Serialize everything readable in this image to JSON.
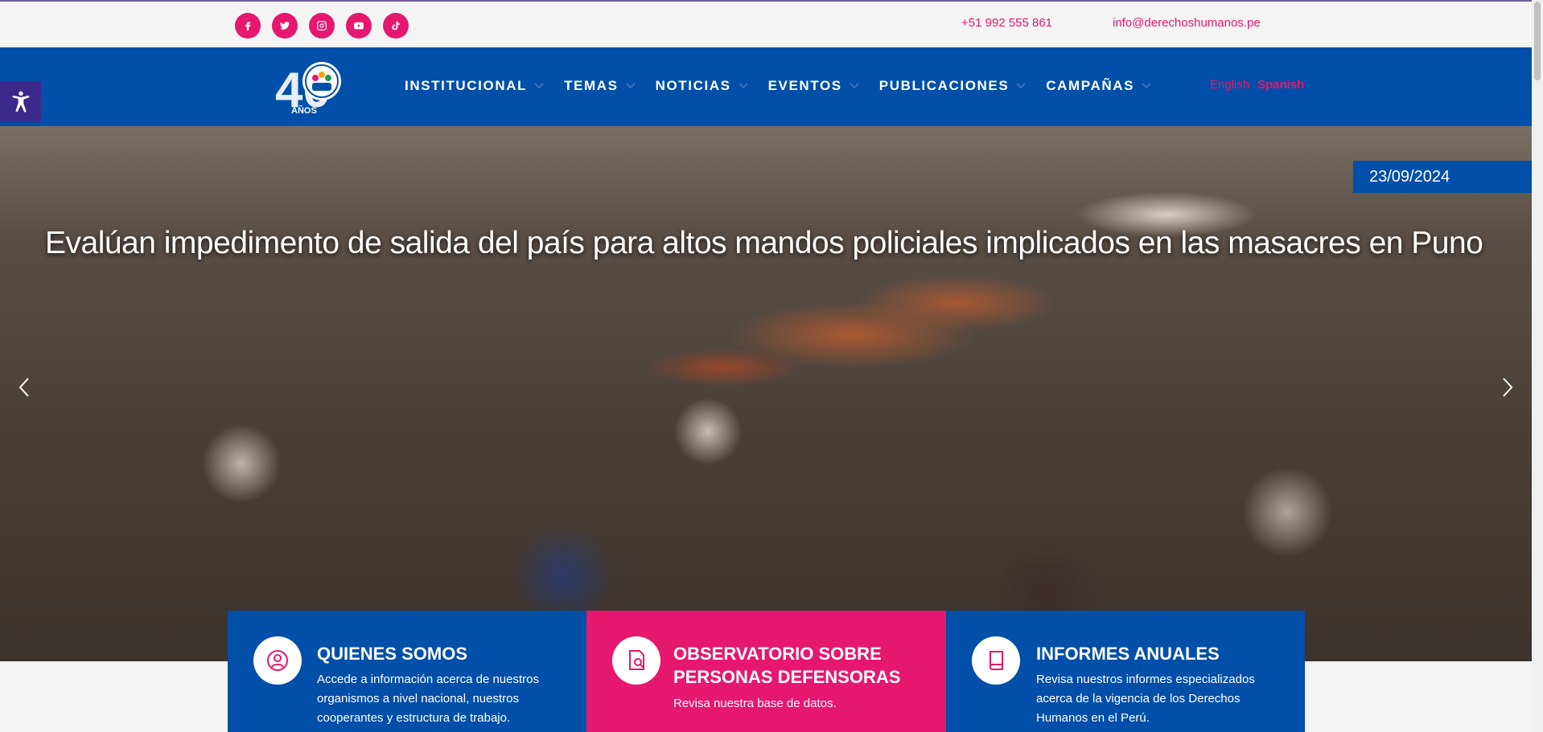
{
  "contact": {
    "phone": "+51 992 555 861",
    "email": "info@derechoshumanos.pe"
  },
  "social": [
    "facebook-icon",
    "twitter-icon",
    "instagram-icon",
    "youtube-icon",
    "tiktok-icon"
  ],
  "logo": {
    "text": "AÑOS",
    "number": "40"
  },
  "nav": [
    "INSTITUCIONAL",
    "TEMAS",
    "NOTICIAS",
    "EVENTOS",
    "PUBLICACIONES",
    "CAMPAÑAS"
  ],
  "lang": {
    "english": "English",
    "spanish": "Spanish"
  },
  "hero": {
    "date": "23/09/2024",
    "title": "Evalúan impedimento de salida del país para altos mandos policiales implicados en las masacres en Puno"
  },
  "cards": [
    {
      "title": "QUIENES SOMOS",
      "text": "Accede a información acerca de nuestros organismos a nivel nacional, nuestros cooperantes y estructura de trabajo.",
      "color": "#004fa8",
      "icon": "user-circle-icon"
    },
    {
      "title": "OBSERVATORIO SOBRE PERSONAS DEFENSORAS",
      "text": "Revisa nuestra base de datos.",
      "color": "#e5176e",
      "icon": "document-search-icon"
    },
    {
      "title": "INFORMES ANUALES",
      "text": "Revisa nuestros informes especializados acerca de la vigencia de los Derechos Humanos en el Perú.",
      "color": "#004fa8",
      "icon": "book-icon"
    }
  ],
  "colors": {
    "brand_blue": "#004fa8",
    "brand_pink": "#e5176e",
    "a11y_purple": "#3b2a8c"
  }
}
